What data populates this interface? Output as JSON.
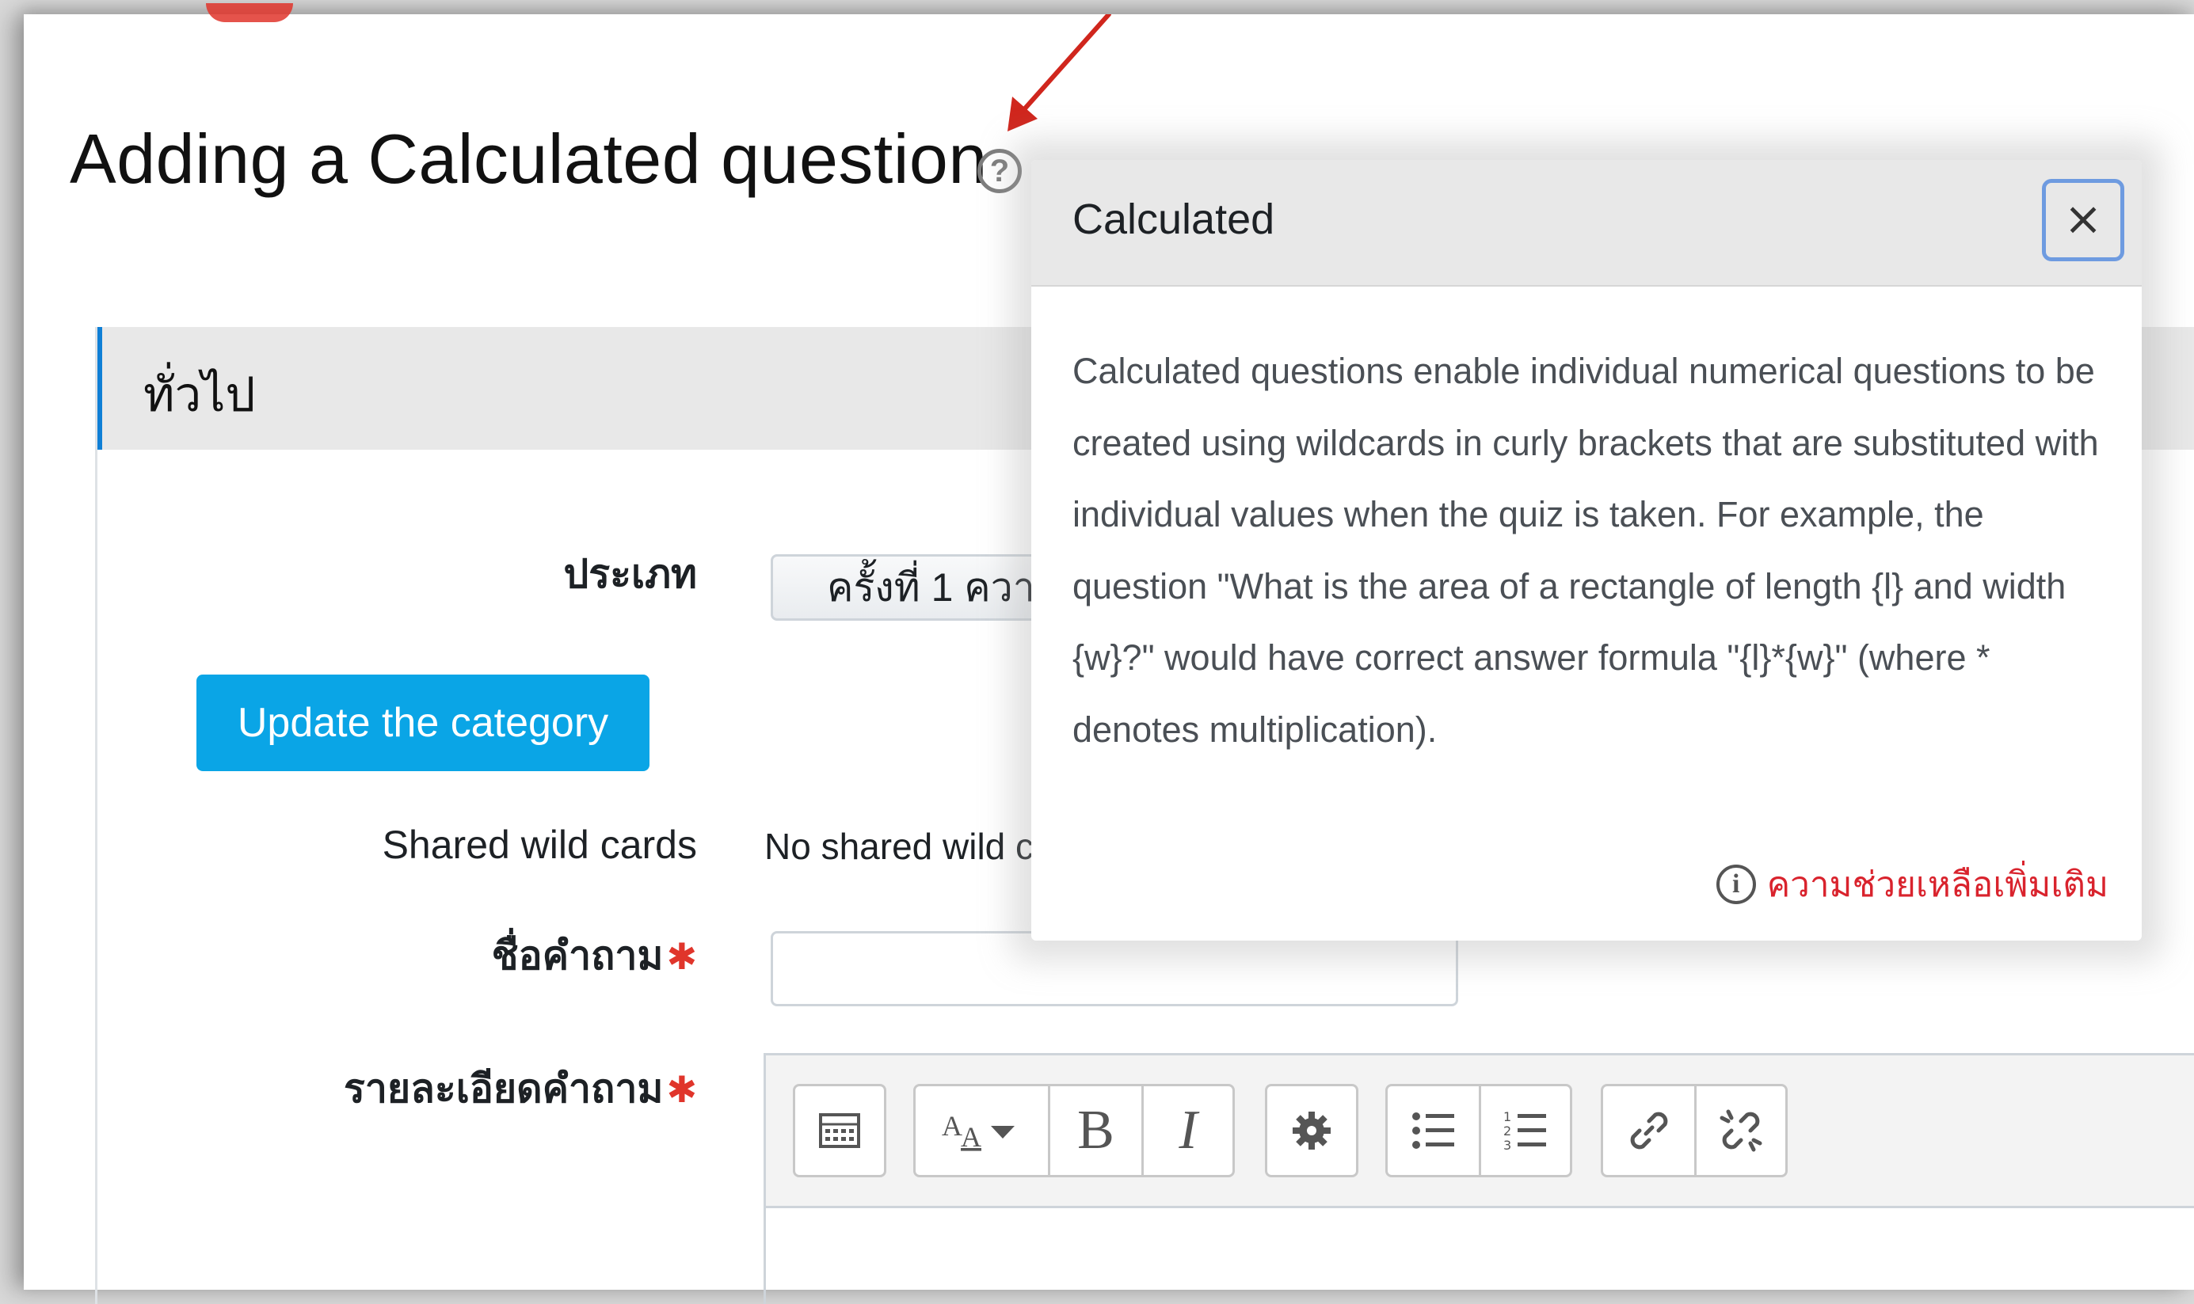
{
  "page": {
    "title": "Adding a Calculated question"
  },
  "section": {
    "title": "ทั่วไป"
  },
  "form": {
    "category_label": "ประเภท",
    "category_value": "ครั้งที่ 1 ความ",
    "update_category_label": "Update the category",
    "shared_wildcards_label": "Shared wild cards",
    "shared_wildcards_value": "No shared wild ca",
    "question_name_label": "ชื่อคำถาม",
    "question_text_label": "รายละเอียดคำถาม",
    "required_mark": "✱"
  },
  "editor": {
    "toolbar_groups": [
      [
        "toolbar-toggle-icon"
      ],
      [
        "font-style-icon",
        "bold-icon",
        "italic-icon"
      ],
      [
        "gear-icon"
      ],
      [
        "unordered-list-icon",
        "ordered-list-icon"
      ],
      [
        "link-icon",
        "unlink-icon"
      ]
    ],
    "bold_glyph": "B",
    "italic_glyph": "I"
  },
  "popover": {
    "title": "Calculated",
    "close_glyph": "×",
    "body": "Calculated questions enable individual numerical questions to be created using wildcards in curly brackets that are substituted with individual values when the quiz is taken. For example, the question \"What is the area of a rectangle of length {l} and width {w}?\" would have correct answer formula \"{l}*{w}\" (where * denotes multiplication).",
    "more_help_label": "ความช่วยเหลือเพิ่มเติม"
  },
  "icons": {
    "help_glyph": "?",
    "info_glyph": "i"
  },
  "colors": {
    "primary_button": "#0aa5e6",
    "required": "#e0352b",
    "link_red": "#d9232d",
    "annotation_arrow": "#d0261d",
    "section_accent": "#0f7fd6",
    "close_focus_ring": "#6e9be0"
  }
}
